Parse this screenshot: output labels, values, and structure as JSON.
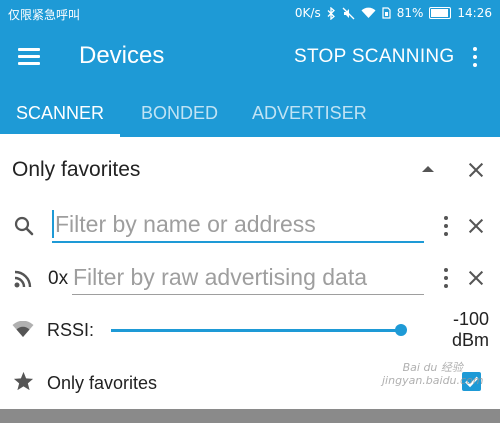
{
  "status_bar": {
    "carrier": "仅限紧急呼叫",
    "speed": "0K/s",
    "battery": "81%",
    "time": "14:26",
    "icons": [
      "bluetooth-icon",
      "mute-icon",
      "wifi-icon",
      "sim-icon",
      "battery-icon"
    ]
  },
  "toolbar": {
    "title": "Devices",
    "stop_label": "STOP SCANNING",
    "menu_icon": "hamburger-menu-icon",
    "overflow_icon": "more-vert-icon"
  },
  "tabs": [
    {
      "label": "SCANNER",
      "active": true
    },
    {
      "label": "BONDED",
      "active": false
    },
    {
      "label": "ADVERTISER",
      "active": false
    }
  ],
  "filter_panel": {
    "title": "Only favorites",
    "name_filter": {
      "placeholder": "Filter by name or address",
      "value": ""
    },
    "raw_filter": {
      "prefix": "0x",
      "placeholder": "Filter by raw advertising data",
      "value": ""
    },
    "rssi": {
      "label": "RSSI:",
      "value": "-100",
      "unit": "dBm",
      "slider_fraction": 1.0
    },
    "favorites": {
      "label": "Only favorites",
      "checked": true
    }
  },
  "watermark": {
    "line1": "Bai du 经验",
    "line2": "jingyan.baidu.com"
  },
  "colors": {
    "accent": "#1e9ad6",
    "icon_gray": "#555555",
    "placeholder": "#9e9e9e"
  }
}
